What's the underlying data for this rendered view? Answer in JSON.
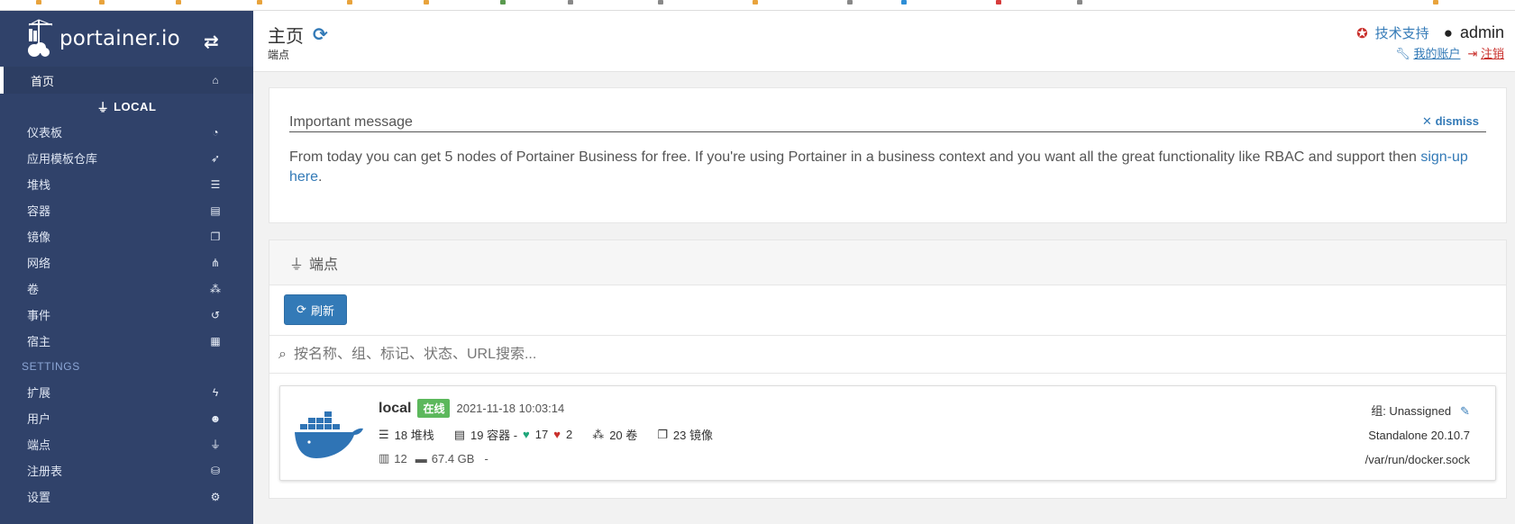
{
  "brand": {
    "name": "portainer.io"
  },
  "sidebar": {
    "home": {
      "label": "首页"
    },
    "endpoint_header": "LOCAL",
    "items": [
      {
        "label": "仪表板",
        "icon": "tachometer-icon"
      },
      {
        "label": "应用模板仓库",
        "icon": "rocket-icon"
      },
      {
        "label": "堆栈",
        "icon": "th-list-icon"
      },
      {
        "label": "容器",
        "icon": "server-icon"
      },
      {
        "label": "镜像",
        "icon": "clone-icon"
      },
      {
        "label": "网络",
        "icon": "sitemap-icon"
      },
      {
        "label": "卷",
        "icon": "cubes-icon"
      },
      {
        "label": "事件",
        "icon": "history-icon"
      },
      {
        "label": "宿主",
        "icon": "th-icon"
      }
    ],
    "settings_title": "SETTINGS",
    "settings_items": [
      {
        "label": "扩展",
        "icon": "bolt-icon"
      },
      {
        "label": "用户",
        "icon": "users-icon"
      },
      {
        "label": "端点",
        "icon": "plug-icon"
      },
      {
        "label": "注册表",
        "icon": "database-icon"
      },
      {
        "label": "设置",
        "icon": "cogs-icon"
      }
    ]
  },
  "header": {
    "title": "主页",
    "subtitle": "端点",
    "support_label": "技术支持",
    "username": "admin",
    "my_account_label": "我的账户",
    "logout_label": "注销"
  },
  "message": {
    "title": "Important message",
    "dismiss_label": "dismiss",
    "body_text": "From today you can get 5 nodes of Portainer Business for free. If you're using Portainer in a business context and you want all the great functionality like RBAC and support then ",
    "link_text": "sign-up here",
    "body_end": "."
  },
  "endpoints": {
    "panel_title": "端点",
    "refresh_label": "刷新",
    "search_placeholder": "按名称、组、标记、状态、URL搜索...",
    "items": [
      {
        "name": "local",
        "status": "在线",
        "timestamp": "2021-11-18 10:03:14",
        "stacks": "18 堆栈",
        "containers": "19 容器 -",
        "healthy": "17",
        "unhealthy": "2",
        "volumes": "20 卷",
        "images": "23 镜像",
        "cpu": "12",
        "memory": "67.4 GB",
        "dash": "-",
        "group": "组: Unassigned",
        "type": "Standalone 20.10.7",
        "url": "/var/run/docker.sock"
      }
    ]
  },
  "colors": {
    "sidebar_bg": "#30426a",
    "primary": "#337ab7",
    "success": "#5cb85c",
    "danger": "#c9302c"
  }
}
